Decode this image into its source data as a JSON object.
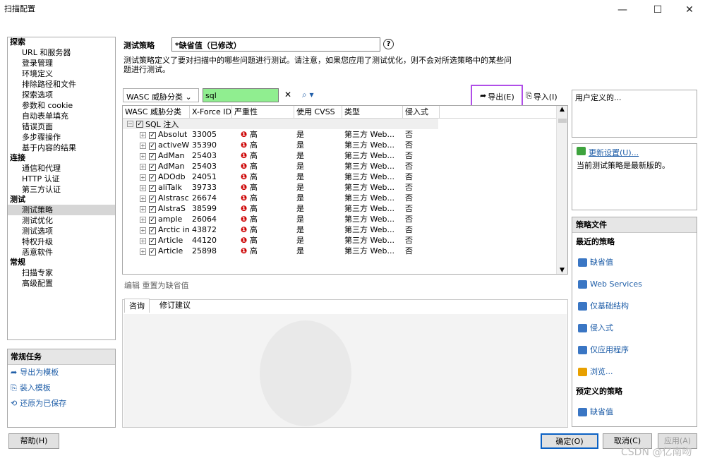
{
  "window": {
    "title": "扫描配置",
    "min": "—",
    "max": "☐",
    "close": "✕"
  },
  "nav": [
    {
      "type": "h",
      "label": "探索"
    },
    {
      "type": "i",
      "label": "URL 和服务器"
    },
    {
      "type": "i",
      "label": "登录管理"
    },
    {
      "type": "i",
      "label": "环境定义"
    },
    {
      "type": "i",
      "label": "排除路径和文件"
    },
    {
      "type": "i",
      "label": "探索选项"
    },
    {
      "type": "i",
      "label": "参数和 cookie"
    },
    {
      "type": "i",
      "label": "自动表单填充"
    },
    {
      "type": "i",
      "label": "错误页面"
    },
    {
      "type": "i",
      "label": "多步骤操作"
    },
    {
      "type": "i",
      "label": "基于内容的结果"
    },
    {
      "type": "h",
      "label": "连接"
    },
    {
      "type": "i",
      "label": "通信和代理"
    },
    {
      "type": "i",
      "label": "HTTP 认证"
    },
    {
      "type": "i",
      "label": "第三方认证"
    },
    {
      "type": "h",
      "label": "测试"
    },
    {
      "type": "i",
      "label": "测试策略",
      "selected": true
    },
    {
      "type": "i",
      "label": "测试优化"
    },
    {
      "type": "i",
      "label": "测试选项"
    },
    {
      "type": "i",
      "label": "特权升级"
    },
    {
      "type": "i",
      "label": "恶意软件"
    },
    {
      "type": "h",
      "label": "常规"
    },
    {
      "type": "i",
      "label": "扫描专家"
    },
    {
      "type": "i",
      "label": "高级配置"
    }
  ],
  "tasks": {
    "title": "常规任务",
    "items": [
      "导出为模板",
      "装入模板",
      "还原为已保存"
    ]
  },
  "help_button": "帮助(H)",
  "policy": {
    "label": "测试策略",
    "name": "*缺省值（已修改）",
    "help": "?",
    "description": "测试策略定义了要对扫描中的哪些问题进行测试。请注意，如果您应用了测试优化，则不会对所选策略中的某些问题进行测试。"
  },
  "filter": {
    "category": "WASC 威胁分类",
    "search": "sql",
    "clear": "✕",
    "search_icon": "⌕ ▾"
  },
  "export_label": "导出(E)",
  "import_label": "导入(I)",
  "grid": {
    "headers": [
      "WASC 威胁分类",
      "X-Force ID",
      "严重性",
      "使用 CVSS",
      "类型",
      "侵入式"
    ],
    "group": "SQL 注入",
    "rows": [
      [
        "Absolut",
        "33005",
        "高",
        "是",
        "第三方 Web...",
        "否"
      ],
      [
        "activeW",
        "35390",
        "高",
        "是",
        "第三方 Web...",
        "否"
      ],
      [
        "AdMan",
        "25403",
        "高",
        "是",
        "第三方 Web...",
        "否"
      ],
      [
        "AdMan",
        "25403",
        "高",
        "是",
        "第三方 Web...",
        "否"
      ],
      [
        "ADOdb",
        "24051",
        "高",
        "是",
        "第三方 Web...",
        "否"
      ],
      [
        "aliTalk",
        "39733",
        "高",
        "是",
        "第三方 Web...",
        "否"
      ],
      [
        "Alstrasc",
        "26674",
        "高",
        "是",
        "第三方 Web...",
        "否"
      ],
      [
        "AlstraS",
        "38599",
        "高",
        "是",
        "第三方 Web...",
        "否"
      ],
      [
        "ample",
        "26064",
        "高",
        "是",
        "第三方 Web...",
        "否"
      ],
      [
        "Arctic in",
        "43872",
        "高",
        "是",
        "第三方 Web...",
        "否"
      ],
      [
        "Article",
        "44120",
        "高",
        "是",
        "第三方 Web...",
        "否"
      ],
      [
        "Article",
        "25898",
        "高",
        "是",
        "第三方 Web...",
        "否"
      ]
    ]
  },
  "edit_links": "编辑  重置为缺省值",
  "tabs": [
    "咨询",
    "修订建议"
  ],
  "right": {
    "user_defined": "用户定义的...",
    "update_link": "更新设置(U)...",
    "update_status": "当前测试策略是最新版的。",
    "policy_files_title": "策略文件",
    "recent_title": "最近的策略",
    "recent": [
      "缺省值",
      "Web Services",
      "仅基础结构",
      "侵入式",
      "仅应用程序"
    ],
    "browse": "浏览...",
    "predefined_title": "预定义的策略",
    "predefined": [
      "缺省值"
    ]
  },
  "buttons": {
    "ok": "确定(O)",
    "cancel": "取消(C)",
    "apply": "应用(A)"
  },
  "watermark_text": "CSDN @亿南吻"
}
